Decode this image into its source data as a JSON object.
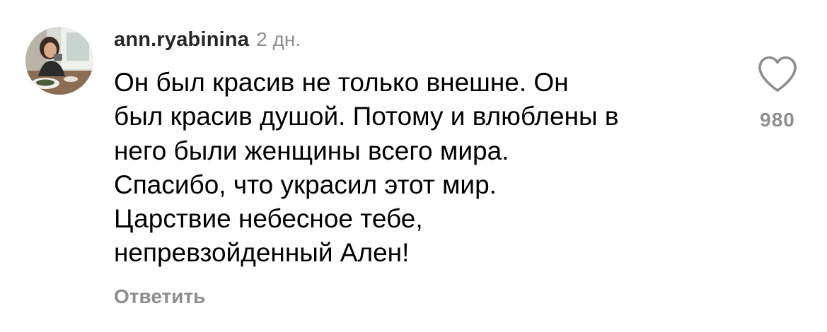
{
  "comment": {
    "username": "ann.ryabinina",
    "timestamp": "2 дн.",
    "text_lines": [
      "Он был красив не только внешне. Он",
      "был красив душой. Потому и влюблены в",
      "него были женщины всего мира.",
      "Спасибо, что украсил этот мир.",
      "Царствие небесное тебе,",
      "непревзойденный Ален!"
    ],
    "reply_label": "Ответить",
    "like_count": "980",
    "like_icon": "heart-outline-icon",
    "avatar": "user-avatar-photo"
  },
  "colors": {
    "primary_text": "#000000",
    "username": "#262626",
    "secondary_text": "#8e8e8e",
    "background": "#ffffff"
  }
}
